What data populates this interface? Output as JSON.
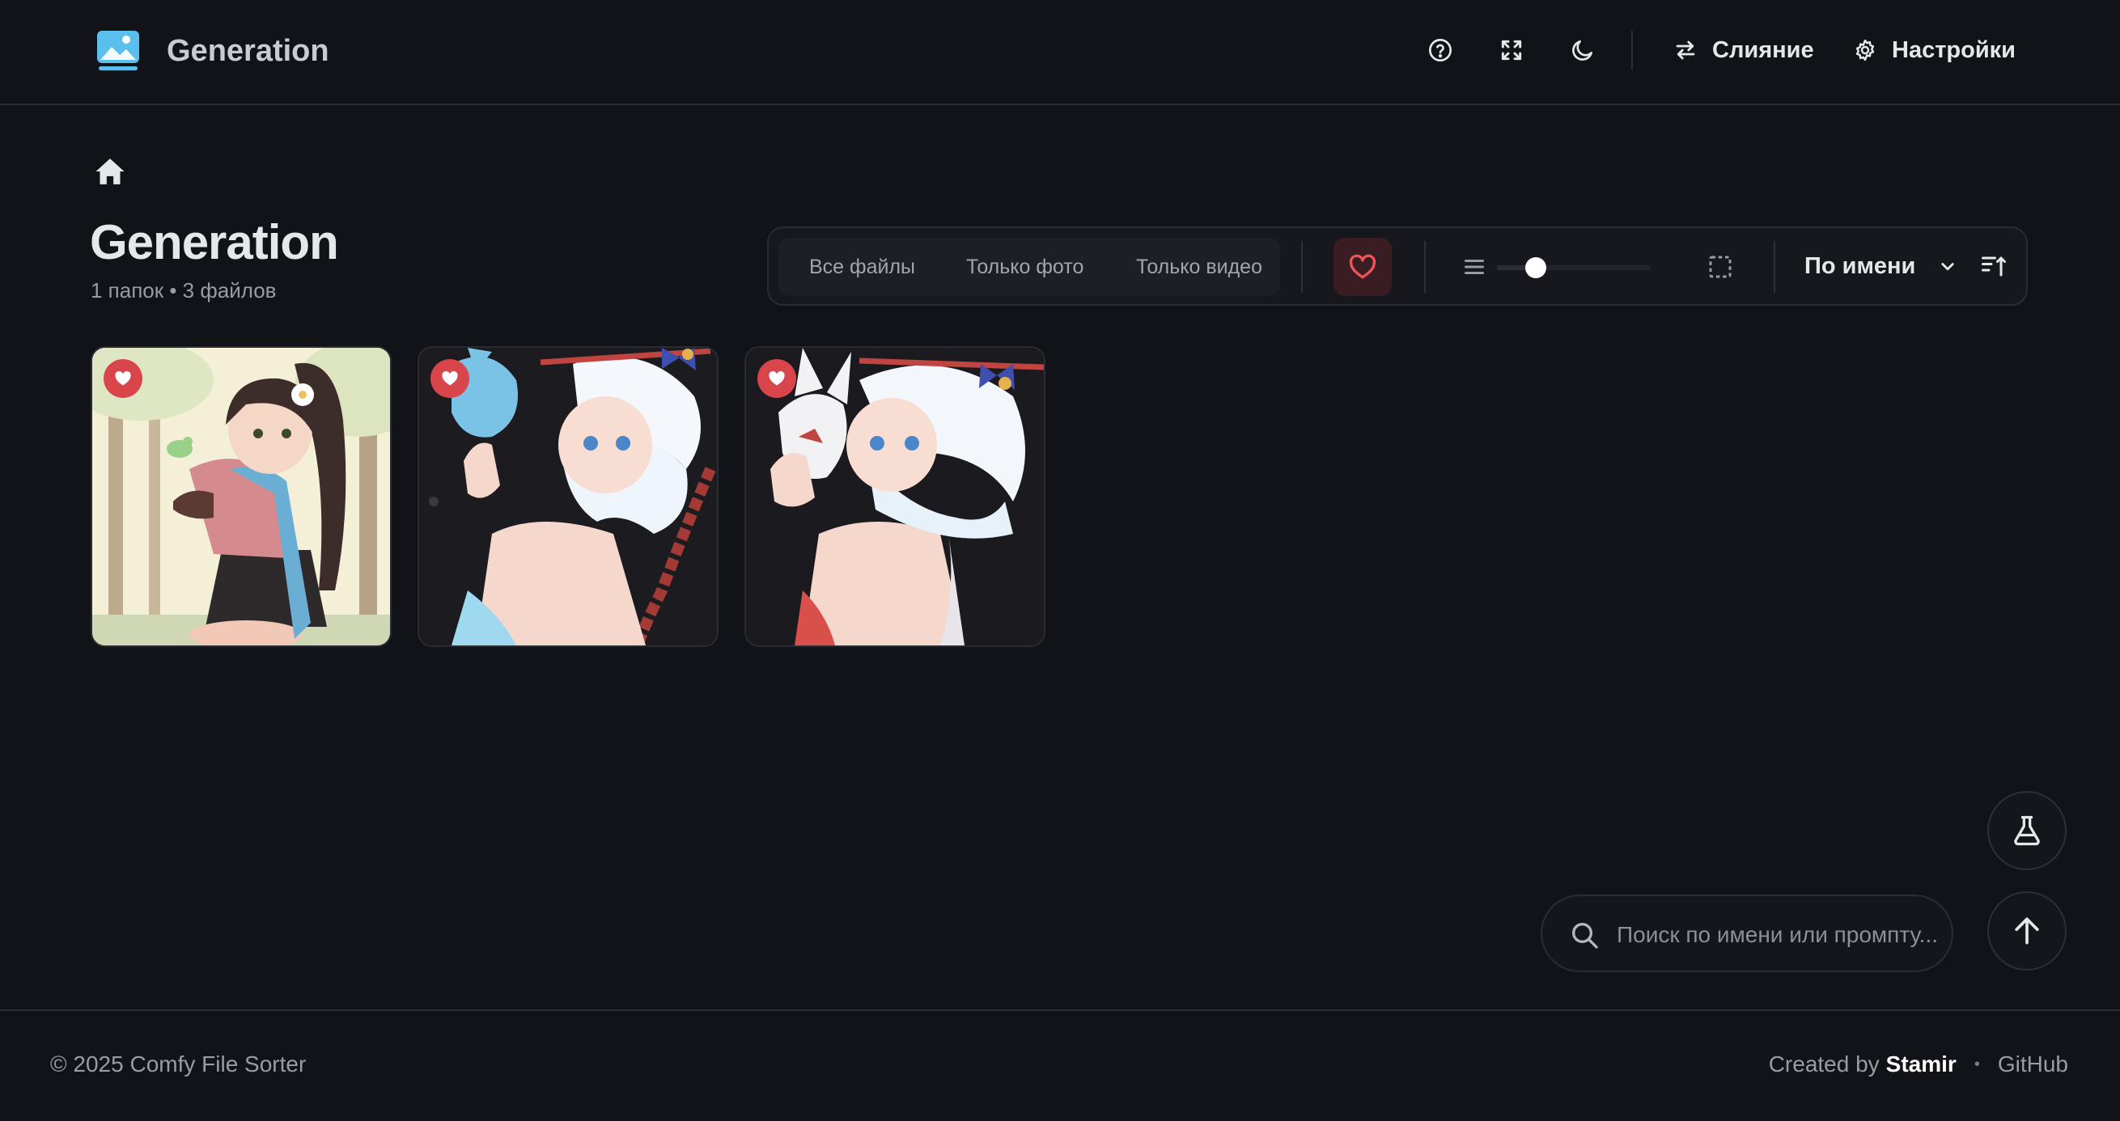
{
  "header": {
    "app_title": "Generation",
    "merge_label": "Слияние",
    "settings_label": "Настройки"
  },
  "page": {
    "title": "Generation",
    "subtitle": "1 папок • 3 файлов"
  },
  "toolbar": {
    "filters": [
      "Все файлы",
      "Только фото",
      "Только видео"
    ],
    "active_filter": "Все файлы",
    "favorites_active": true,
    "size_level": 0.25,
    "sort_label": "По имени"
  },
  "gallery": {
    "items": [
      {
        "favorite": true,
        "scene": "girl-with-bird-forest"
      },
      {
        "favorite": true,
        "scene": "girl-with-blue-fox-mask"
      },
      {
        "favorite": true,
        "scene": "girl-with-white-fox-mask"
      }
    ]
  },
  "search": {
    "placeholder": "Поиск по имени или промпту..."
  },
  "footer": {
    "copyright": "© 2025 Comfy File Sorter",
    "created_by": "Created by",
    "author": "Stamir",
    "separator": "•",
    "github": "GitHub"
  },
  "colors": {
    "background": "#121318",
    "accent_red": "#d8464b",
    "logo_blue": "#5bbfee"
  },
  "icons": {
    "header": [
      "help-icon",
      "fullscreen-icon",
      "moon-icon",
      "swap-arrows-icon",
      "gear-icon"
    ],
    "fabs": [
      "flask-icon",
      "arrow-up-icon"
    ]
  }
}
